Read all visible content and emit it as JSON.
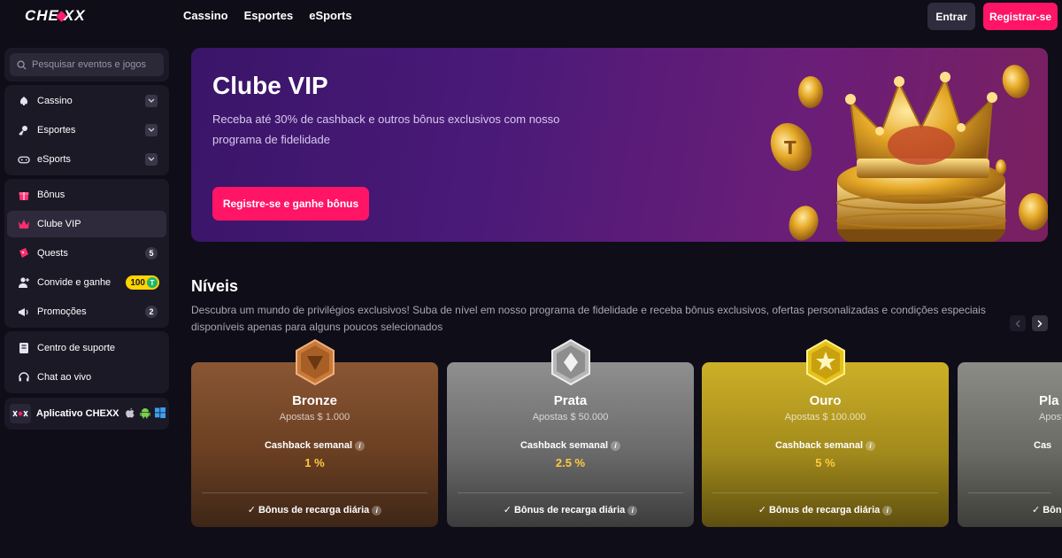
{
  "brand": {
    "logo_text_left": "CHE",
    "logo_text_right": "XX"
  },
  "topnav": [
    {
      "label": "Cassino"
    },
    {
      "label": "Esportes"
    },
    {
      "label": "eSports"
    }
  ],
  "auth": {
    "login_label": "Entrar",
    "register_label": "Registrar-se"
  },
  "sidebar": {
    "search_placeholder": "Pesquisar eventos e jogos",
    "sports": [
      {
        "label": "Cassino",
        "icon": "cards-icon"
      },
      {
        "label": "Esportes",
        "icon": "ball-icon"
      },
      {
        "label": "eSports",
        "icon": "gamepad-icon"
      }
    ],
    "promo": [
      {
        "label": "Bônus",
        "icon": "gift-icon"
      },
      {
        "label": "Clube VIP",
        "icon": "crown-icon",
        "active": true
      },
      {
        "label": "Quests",
        "icon": "ticket-icon",
        "badge": "5"
      },
      {
        "label": "Convide e ganhe",
        "icon": "user-plus-icon",
        "coin": "100",
        "coin_symbol": "T"
      },
      {
        "label": "Promoções",
        "icon": "megaphone-icon",
        "badge": "2"
      }
    ],
    "help": [
      {
        "label": "Centro de suporte",
        "icon": "book-icon"
      },
      {
        "label": "Chat ao vivo",
        "icon": "headset-icon"
      }
    ],
    "app": {
      "label": "Aplicativo CHEXX"
    }
  },
  "hero": {
    "title": "Clube VIP",
    "description": "Receba até 30% de cashback e outros bônus exclusivos com nosso programa de fidelidade",
    "button_label": "Registre-se e ganhe bônus"
  },
  "levels": {
    "title": "Níveis",
    "description": "Descubra um mundo de privilégios exclusivos! Suba de nível em nosso programa de fidelidade e receba bônus exclusivos, ofertas personalizadas e condições especiais disponíveis apenas para alguns poucos selecionados",
    "cards": [
      {
        "name": "Bronze",
        "bets": "Apostas $ 1.000",
        "cashback_label": "Cashback semanal",
        "cashback_value": "1 %",
        "bonus": "Bônus de recarga diária"
      },
      {
        "name": "Prata",
        "bets": "Apostas $ 50.000",
        "cashback_label": "Cashback semanal",
        "cashback_value": "2.5 %",
        "bonus": "Bônus de recarga diária"
      },
      {
        "name": "Ouro",
        "bets": "Apostas $ 100.000",
        "cashback_label": "Cashback semanal",
        "cashback_value": "5 %",
        "bonus": "Bônus de recarga diária"
      },
      {
        "name_partial": "Pla",
        "bets_partial": "Aposta",
        "cashback_partial": "Cas",
        "bonus_partial": "Bôn"
      }
    ]
  },
  "colors": {
    "accent": "#ff1466",
    "background": "#0f0d18",
    "sidebar": "#1c1927",
    "cashback": "#ffcb3d"
  }
}
